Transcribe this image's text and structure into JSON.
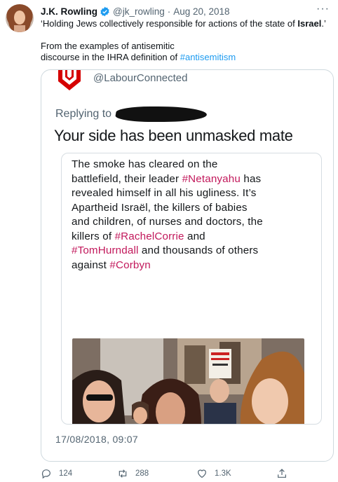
{
  "author": {
    "name": "J.K. Rowling",
    "handle": "@jk_rowling",
    "separator": "·",
    "date": "Aug 20, 2018"
  },
  "more_label": "···",
  "tweet": {
    "quote_line": "‘Holding Jews collectively responsible for actions of the state of ",
    "quote_bold": "Israel",
    "quote_end": ".’",
    "body_line1": "From the examples of antisemitic",
    "body_line2": "discourse in the IHRA definition of ",
    "hashtag": "#antisemitism"
  },
  "embedded": {
    "handle": "@LabourConnected",
    "replying_to": "Replying to",
    "text": "Your side has been unmasked mate",
    "quote": {
      "l1": "The smoke has cleared on the",
      "l2a": "battlefield, their leader ",
      "l2tag": "#Netanyahu",
      "l2b": " has",
      "l3": "revealed himself in all his ugliness. It’s",
      "l4": "Apartheid Israël, the killers of babies",
      "l5": "and children, of nurses and doctors, the",
      "l6a": "killers of ",
      "l6tag": "#RachelCorrie",
      "l6b": " and",
      "l7tag": "#TomHurndall",
      "l7b": " and thousands of others",
      "l8a": "against ",
      "l8tag": "#Corbyn"
    },
    "timestamp": "17/08/2018, 09:07"
  },
  "actions": {
    "replies": "124",
    "retweets": "288",
    "likes": "1.3K"
  },
  "colors": {
    "link_blue": "#1d9bf0",
    "hashtag_pink": "#c2185b",
    "labour_red": "#d50000"
  }
}
